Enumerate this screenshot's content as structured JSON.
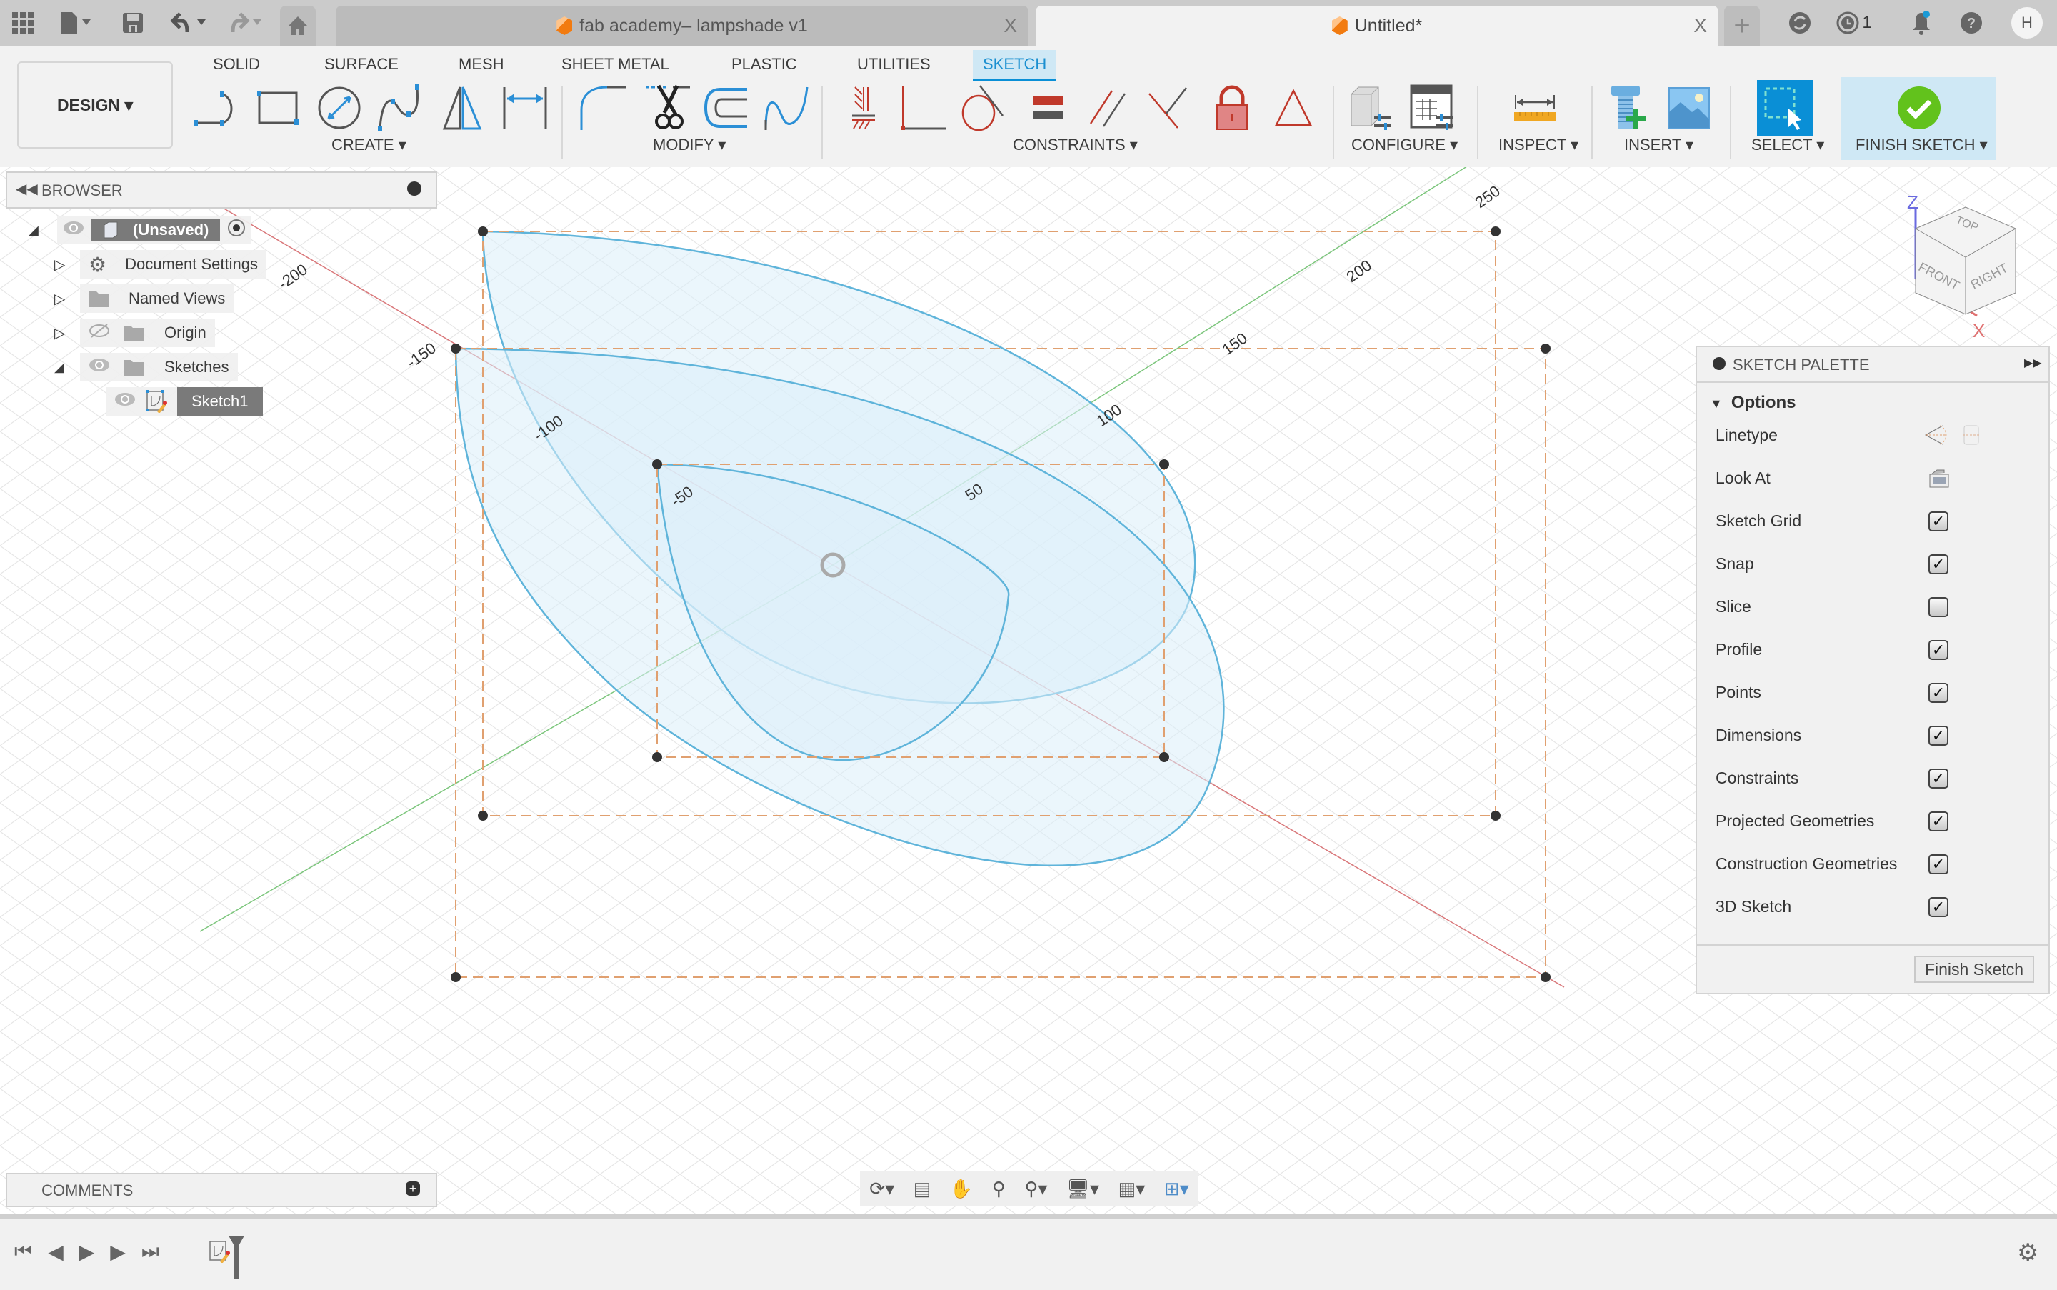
{
  "topbar": {
    "icons": [
      "apps-grid-icon",
      "file-icon",
      "save-icon",
      "undo-icon",
      "redo-icon",
      "home-icon"
    ],
    "tabs": [
      {
        "title": "fab academy– lampshade v1",
        "active": false,
        "close": "X"
      },
      {
        "title": "Untitled*",
        "active": true,
        "close": "X"
      }
    ],
    "new_tab": "+",
    "job_count": "1",
    "user_initials": "H"
  },
  "ribbon": {
    "workspace": "DESIGN ▾",
    "tabs": [
      "SOLID",
      "SURFACE",
      "MESH",
      "SHEET METAL",
      "PLASTIC",
      "UTILITIES",
      "SKETCH"
    ],
    "active_tab": "SKETCH",
    "groups": {
      "create": "CREATE ▾",
      "modify": "MODIFY ▾",
      "constraints": "CONSTRAINTS ▾",
      "configure": "CONFIGURE ▾",
      "inspect": "INSPECT ▾",
      "insert": "INSERT ▾",
      "select": "SELECT ▾",
      "finish": "FINISH SKETCH ▾"
    }
  },
  "browser": {
    "title": "BROWSER",
    "items": [
      {
        "label": "(Unsaved)",
        "level": 0,
        "expanded": true,
        "visible": true
      },
      {
        "label": "Document Settings",
        "level": 1,
        "expanded": false
      },
      {
        "label": "Named Views",
        "level": 1,
        "expanded": false
      },
      {
        "label": "Origin",
        "level": 1,
        "expanded": false,
        "visible": false
      },
      {
        "label": "Sketches",
        "level": 1,
        "expanded": true,
        "visible": true
      },
      {
        "label": "Sketch1",
        "level": 2,
        "visible": true,
        "selected": true
      }
    ]
  },
  "viewport": {
    "axis_labels": {
      "x_neg": [
        "-200",
        "-150",
        "-100",
        "-50"
      ],
      "y_pos": [
        "50",
        "100",
        "150",
        "200",
        "250"
      ]
    },
    "viewcube": {
      "top": "TOP",
      "front": "FRONT",
      "right": "RIGHT",
      "z": "Z",
      "x": "X"
    },
    "colors": {
      "profile_fill": "#dbeefa",
      "profile_stroke": "#5fb4da",
      "construction": "#e0a070",
      "x_axis": "#d9777a",
      "y_axis": "#7cc67c"
    }
  },
  "sketch_palette": {
    "title": "SKETCH PALETTE",
    "section": "Options",
    "rows": [
      {
        "label": "Linetype",
        "type": "icons"
      },
      {
        "label": "Look At",
        "type": "button"
      },
      {
        "label": "Sketch Grid",
        "type": "checkbox",
        "checked": true
      },
      {
        "label": "Snap",
        "type": "checkbox",
        "checked": true
      },
      {
        "label": "Slice",
        "type": "checkbox",
        "checked": false
      },
      {
        "label": "Profile",
        "type": "checkbox",
        "checked": true
      },
      {
        "label": "Points",
        "type": "checkbox",
        "checked": true
      },
      {
        "label": "Dimensions",
        "type": "checkbox",
        "checked": true
      },
      {
        "label": "Constraints",
        "type": "checkbox",
        "checked": true
      },
      {
        "label": "Projected Geometries",
        "type": "checkbox",
        "checked": true
      },
      {
        "label": "Construction Geometries",
        "type": "checkbox",
        "checked": true
      },
      {
        "label": "3D Sketch",
        "type": "checkbox",
        "checked": true
      }
    ],
    "finish_button": "Finish Sketch"
  },
  "comments": {
    "title": "COMMENTS"
  },
  "check_mark": "✓"
}
